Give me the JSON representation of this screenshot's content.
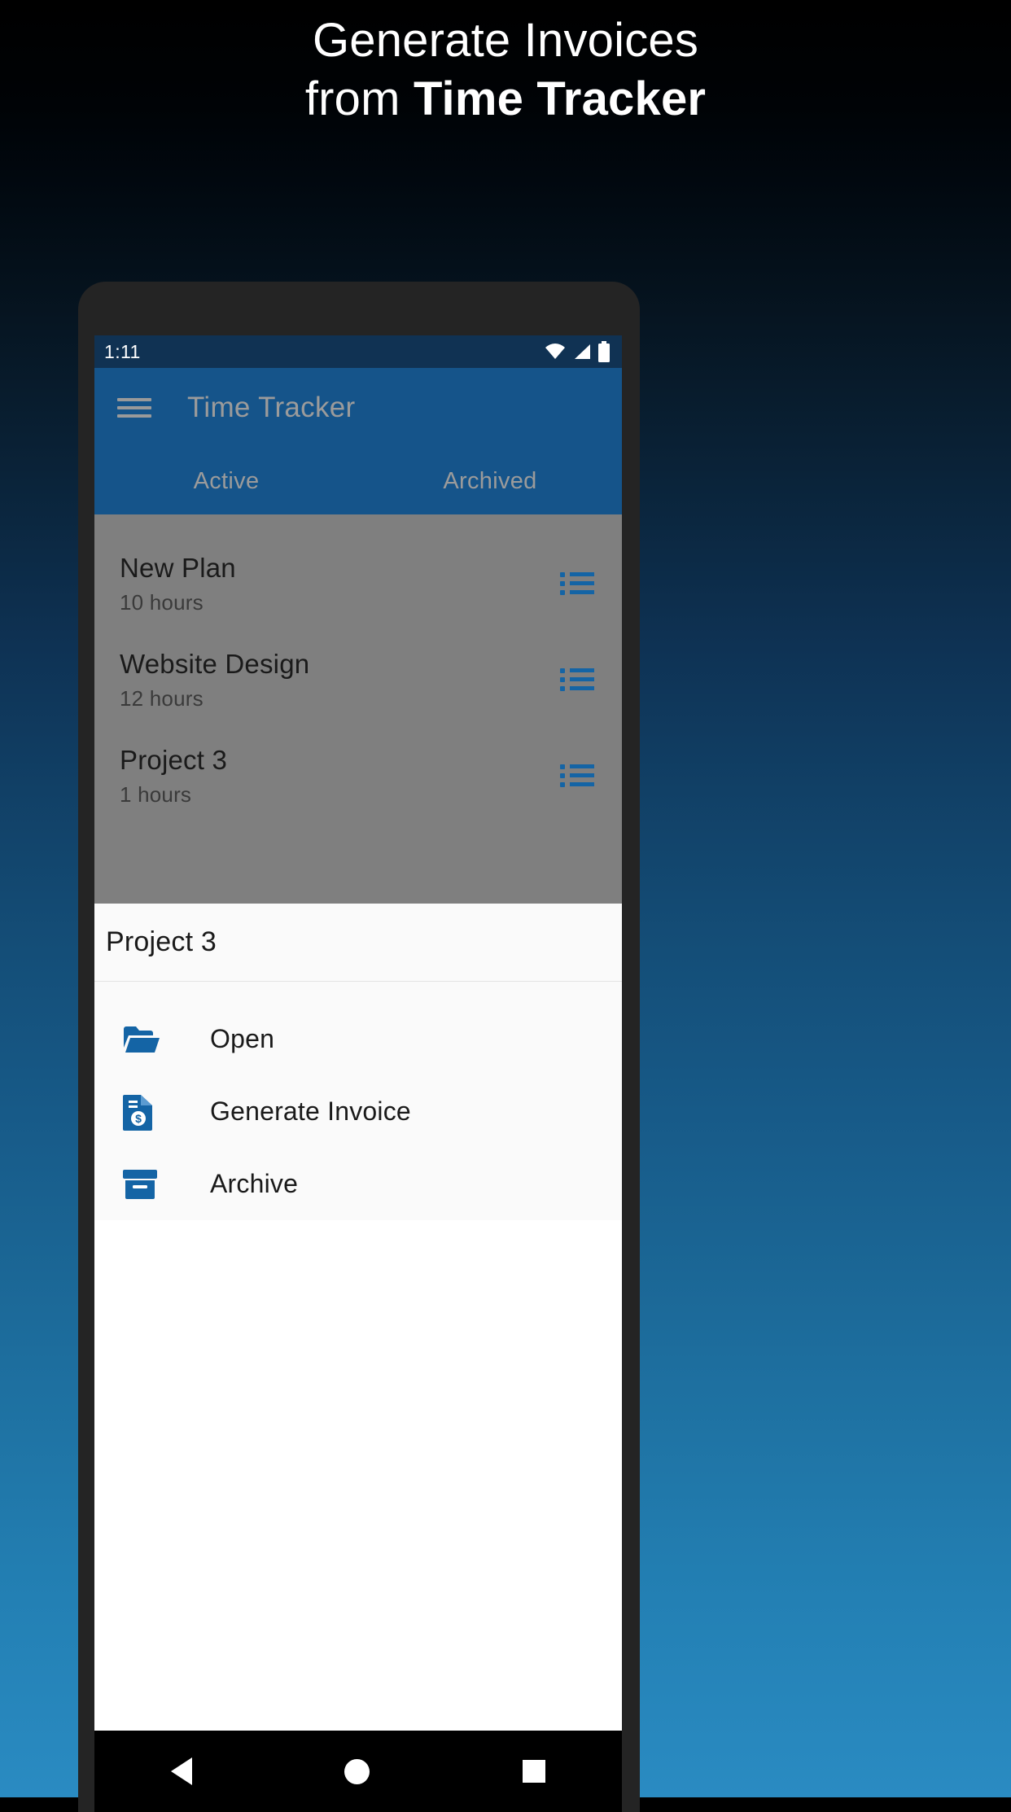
{
  "headline": {
    "line1": "Generate Invoices",
    "line2_prefix": "from ",
    "line2_bold": "Time Tracker"
  },
  "colors": {
    "accent": "#1464a5",
    "appbar": "#15548a",
    "statusbar": "#103253",
    "scrim": "#7f7f7f",
    "sheet_bg": "#fafafa"
  },
  "statusbar": {
    "clock": "1:11",
    "icons": [
      "wifi-icon",
      "signal-icon",
      "battery-icon"
    ]
  },
  "appbar": {
    "menu_icon": "hamburger-menu-icon",
    "title": "Time Tracker",
    "tabs": [
      {
        "label": "Active"
      },
      {
        "label": "Archived"
      }
    ]
  },
  "project_list": [
    {
      "title": "New Plan",
      "subtitle": "10 hours",
      "icon": "list-icon"
    },
    {
      "title": "Website Design",
      "subtitle": "12 hours",
      "icon": "list-icon"
    },
    {
      "title": "Project 3",
      "subtitle": "1 hours",
      "icon": "list-icon"
    }
  ],
  "bottom_sheet": {
    "title": "Project 3",
    "items": [
      {
        "label": "Open",
        "icon": "folder-open-icon"
      },
      {
        "label": "Generate Invoice",
        "icon": "invoice-document-icon"
      },
      {
        "label": "Archive",
        "icon": "archive-box-icon"
      }
    ]
  },
  "navbar": {
    "back": "back-triangle-icon",
    "home": "home-circle-icon",
    "recents": "recents-square-icon"
  }
}
